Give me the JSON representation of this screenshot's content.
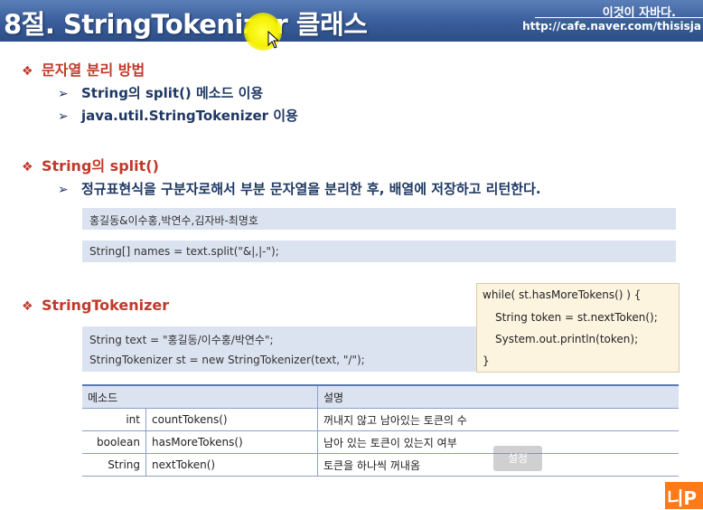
{
  "header": {
    "title": "8절. StringTokenizer 클래스",
    "brand": "이것이 자바다.",
    "url": "http://cafe.naver.com/thisisja"
  },
  "section1": {
    "bullet": "문자열 분리 방법",
    "items": [
      "String의 split() 메소드 이용",
      "java.util.StringTokenizer 이용"
    ]
  },
  "section2": {
    "bullet": "String의 split()",
    "item": "정규표현식을 구분자로해서 부분 문자열을 분리한 후, 배열에 저장하고 리턴한다.",
    "box1": "홍길동&이수홍,박연수,김자바-최명호",
    "box2": "String[] names = text.split(\"&|,|-\");"
  },
  "section3": {
    "bullet": "StringTokenizer",
    "code_lines": [
      "String text = \"홍길동/이수홍/박연수\";",
      "StringTokenizer st = new StringTokenizer(text,  \"/\");"
    ],
    "popup_lines": [
      "while( st.hasMoreTokens() ) {",
      "String token = st.nextToken();",
      "System.out.println(token);",
      "}"
    ]
  },
  "table": {
    "headers": [
      "메소드",
      "설명"
    ],
    "rows": [
      {
        "type": "int",
        "name": "countTokens()",
        "desc": "꺼내지 않고 남아있는 토큰의 수"
      },
      {
        "type": "boolean",
        "name": "hasMoreTokens()",
        "desc": "남아 있는 토큰이 있는지 여부"
      },
      {
        "type": "String",
        "name": "nextToken()",
        "desc": "토큰을 하나씩 꺼내옴"
      }
    ]
  },
  "overlay": {
    "caption": "설정",
    "logo": "니P"
  },
  "colors": {
    "header": "#3b5f9c",
    "bullet": "#c0392b",
    "subtext": "#1f3864",
    "box": "#dce3f0",
    "popup": "#fdf4e0"
  }
}
